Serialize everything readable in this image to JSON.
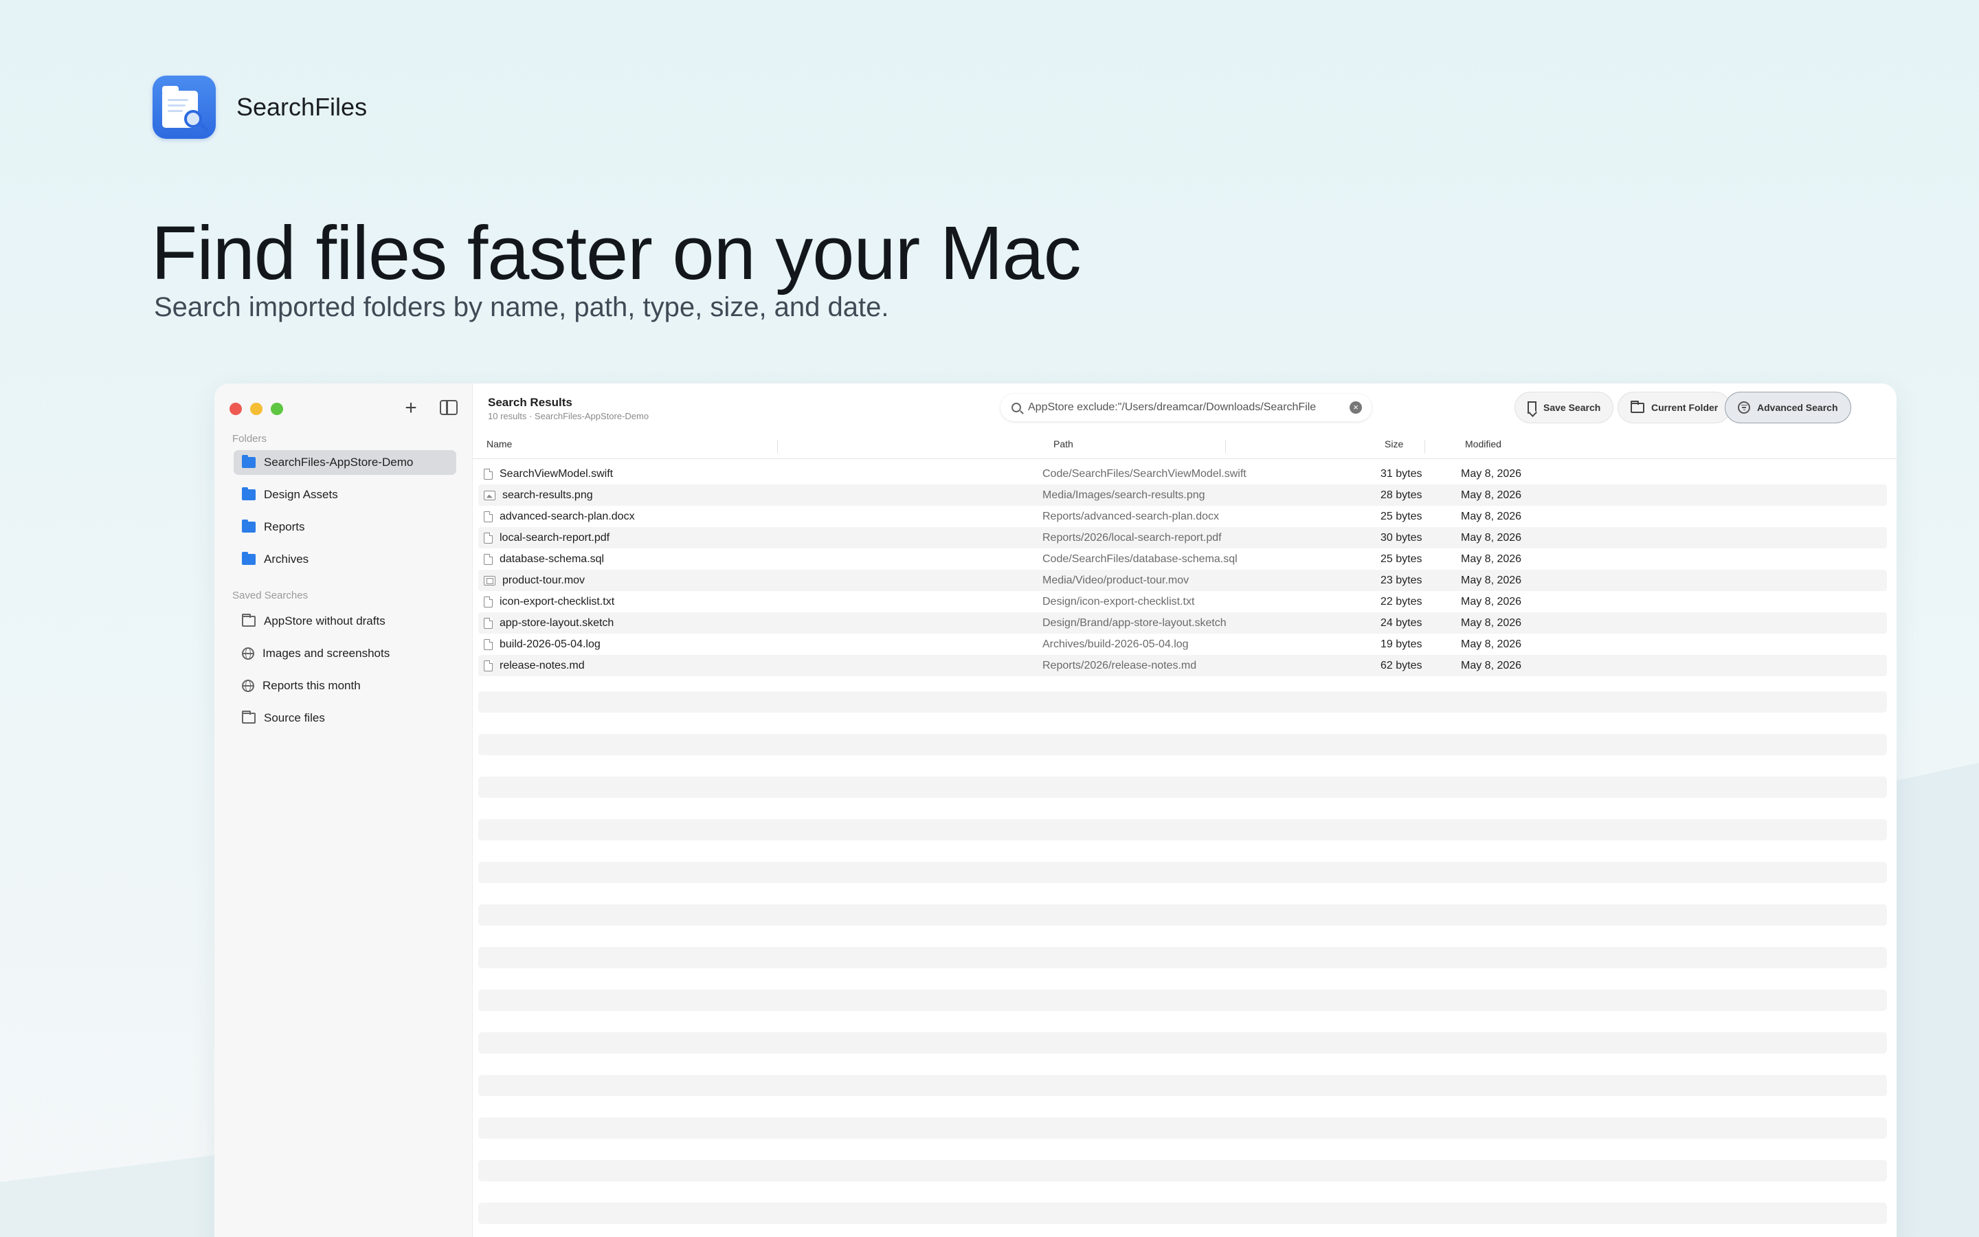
{
  "app": {
    "name": "SearchFiles",
    "logo_icon": "searchfiles-app-icon"
  },
  "hero": {
    "headline": "Find files faster on your Mac",
    "subheadline": "Search imported folders by name, path, type, size, and date."
  },
  "sidebar": {
    "folders_label": "Folders",
    "folders": [
      {
        "label": "SearchFiles-AppStore-Demo",
        "icon": "folder-blue-icon",
        "active": true
      },
      {
        "label": "Design Assets",
        "icon": "folder-blue-icon"
      },
      {
        "label": "Reports",
        "icon": "folder-blue-icon"
      },
      {
        "label": "Archives",
        "icon": "folder-blue-icon"
      }
    ],
    "saved_label": "Saved Searches",
    "saved": [
      {
        "label": "AppStore without drafts",
        "icon": "folder-outline-icon"
      },
      {
        "label": "Images and screenshots",
        "icon": "globe-icon"
      },
      {
        "label": "Reports this month",
        "icon": "globe-icon"
      },
      {
        "label": "Source files",
        "icon": "folder-outline-icon"
      }
    ]
  },
  "main": {
    "title": "Search Results",
    "subtitle": "10 results · SearchFiles-AppStore-Demo",
    "search_query": "AppStore exclude:\"/Users/dreamcar/Downloads/SearchFile",
    "buttons": {
      "save_search": "Save Search",
      "current_folder": "Current Folder",
      "advanced_search": "Advanced Search"
    },
    "columns": {
      "name": "Name",
      "path": "Path",
      "size": "Size",
      "modified": "Modified"
    },
    "rows": [
      {
        "name": "SearchViewModel.swift",
        "path": "Code/SearchFiles/SearchViewModel.swift",
        "size": "31 bytes",
        "modified": "May 8, 2026",
        "icon": "doc"
      },
      {
        "name": "search-results.png",
        "path": "Media/Images/search-results.png",
        "size": "28 bytes",
        "modified": "May 8, 2026",
        "icon": "img"
      },
      {
        "name": "advanced-search-plan.docx",
        "path": "Reports/advanced-search-plan.docx",
        "size": "25 bytes",
        "modified": "May 8, 2026",
        "icon": "doc"
      },
      {
        "name": "local-search-report.pdf",
        "path": "Reports/2026/local-search-report.pdf",
        "size": "30 bytes",
        "modified": "May 8, 2026",
        "icon": "doc"
      },
      {
        "name": "database-schema.sql",
        "path": "Code/SearchFiles/database-schema.sql",
        "size": "25 bytes",
        "modified": "May 8, 2026",
        "icon": "doc"
      },
      {
        "name": "product-tour.mov",
        "path": "Media/Video/product-tour.mov",
        "size": "23 bytes",
        "modified": "May 8, 2026",
        "icon": "vid"
      },
      {
        "name": "icon-export-checklist.txt",
        "path": "Design/icon-export-checklist.txt",
        "size": "22 bytes",
        "modified": "May 8, 2026",
        "icon": "doc"
      },
      {
        "name": "app-store-layout.sketch",
        "path": "Design/Brand/app-store-layout.sketch",
        "size": "24 bytes",
        "modified": "May 8, 2026",
        "icon": "doc"
      },
      {
        "name": "build-2026-05-04.log",
        "path": "Archives/build-2026-05-04.log",
        "size": "19 bytes",
        "modified": "May 8, 2026",
        "icon": "doc"
      },
      {
        "name": "release-notes.md",
        "path": "Reports/2026/release-notes.md",
        "size": "62 bytes",
        "modified": "May 8, 2026",
        "icon": "doc"
      }
    ]
  }
}
